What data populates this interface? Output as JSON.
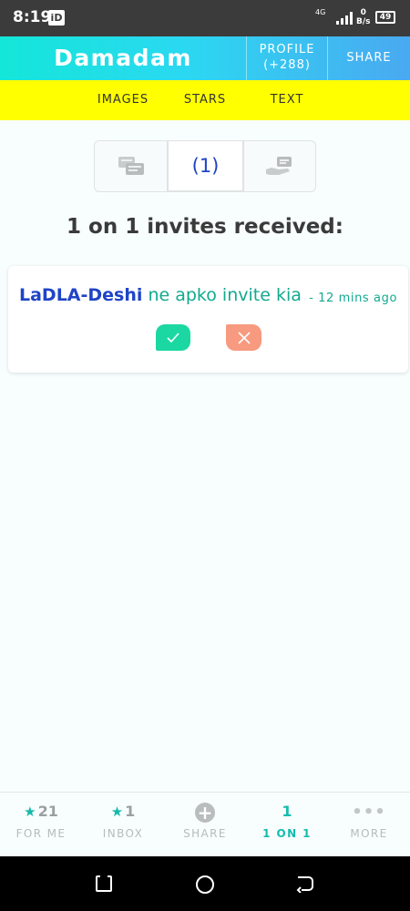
{
  "status_bar": {
    "time": "8:19",
    "id_badge": "iD",
    "network": "4G",
    "speed_value": "0",
    "speed_unit": "B/s",
    "battery": "49"
  },
  "header": {
    "brand": "Damadam",
    "profile_label": "PROFILE",
    "profile_count": "(+288)",
    "share_label": "SHARE",
    "gradient": [
      "#14e6d9",
      "#4aa9f1"
    ]
  },
  "subnav": {
    "items": [
      "IMAGES",
      "STARS",
      "TEXT"
    ],
    "background": "#ffff00"
  },
  "tabs": {
    "left_icon": "chat-bubbles-icon",
    "middle_count": "(1)",
    "right_icon": "hand-with-message-icon"
  },
  "heading": "1 on 1 invites received:",
  "invite": {
    "username": "LaDLA-Deshi",
    "message": "ne apko invite kia",
    "time": "- 12 mins ago",
    "accept_icon": "check-icon",
    "reject_icon": "close-icon"
  },
  "bottom_nav": [
    {
      "count": "21",
      "label": "FOR ME",
      "icon": "star-icon"
    },
    {
      "count": "1",
      "label": "INBOX",
      "icon": "star-icon"
    },
    {
      "count": "+",
      "label": "SHARE",
      "icon": "plus-circle-icon"
    },
    {
      "count": "1",
      "label": "1 ON 1",
      "icon": ""
    },
    {
      "count": "•••",
      "label": "MORE",
      "icon": "more-dots-icon"
    }
  ],
  "colors": {
    "accent": "#14bcb0",
    "link_blue": "#1f44c6",
    "green_text": "#12a98f",
    "accept": "#1bd8a3",
    "reject": "#f79a80"
  }
}
